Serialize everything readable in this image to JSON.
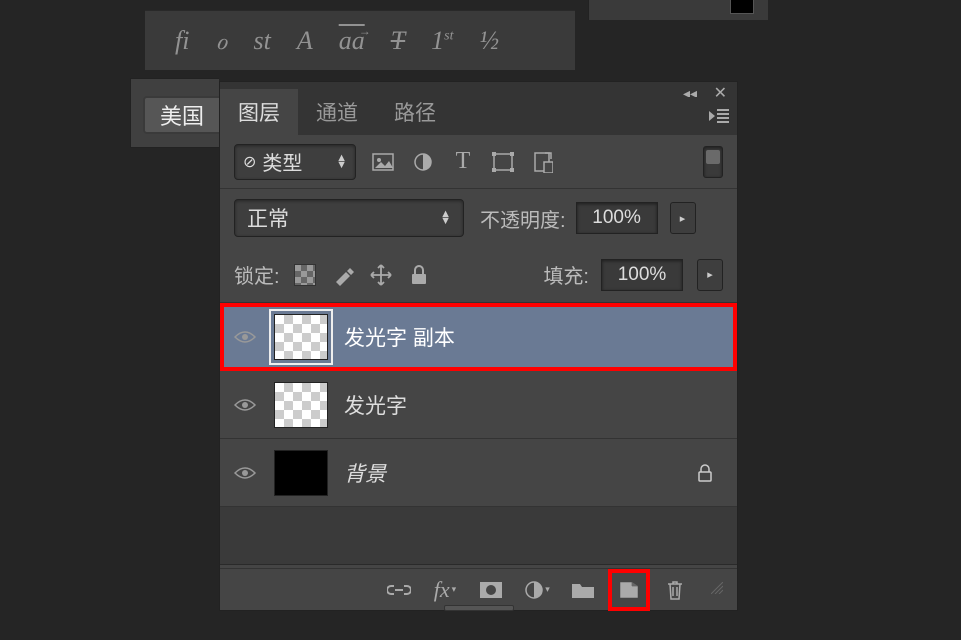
{
  "top_toolbar": {
    "typography_icons": [
      "fi",
      "ℴ",
      "st",
      "A",
      "aa",
      "T",
      "1st",
      "½"
    ]
  },
  "left_button_label": "美国",
  "panel": {
    "tabs": [
      {
        "label": "图层",
        "active": true
      },
      {
        "label": "通道",
        "active": false
      },
      {
        "label": "路径",
        "active": false
      }
    ],
    "filter_dropdown": "类型",
    "blend_mode": "正常",
    "opacity_label": "不透明度:",
    "opacity_value": "100%",
    "lock_label": "锁定:",
    "fill_label": "填充:",
    "fill_value": "100%",
    "layers": [
      {
        "name": "发光字 副本",
        "thumb": "checker",
        "selected": true,
        "highlighted": true,
        "locked": false
      },
      {
        "name": "发光字",
        "thumb": "checker",
        "selected": false,
        "highlighted": false,
        "locked": false
      },
      {
        "name": "背景",
        "thumb": "black",
        "selected": false,
        "highlighted": false,
        "locked": true,
        "italic": true
      }
    ]
  }
}
